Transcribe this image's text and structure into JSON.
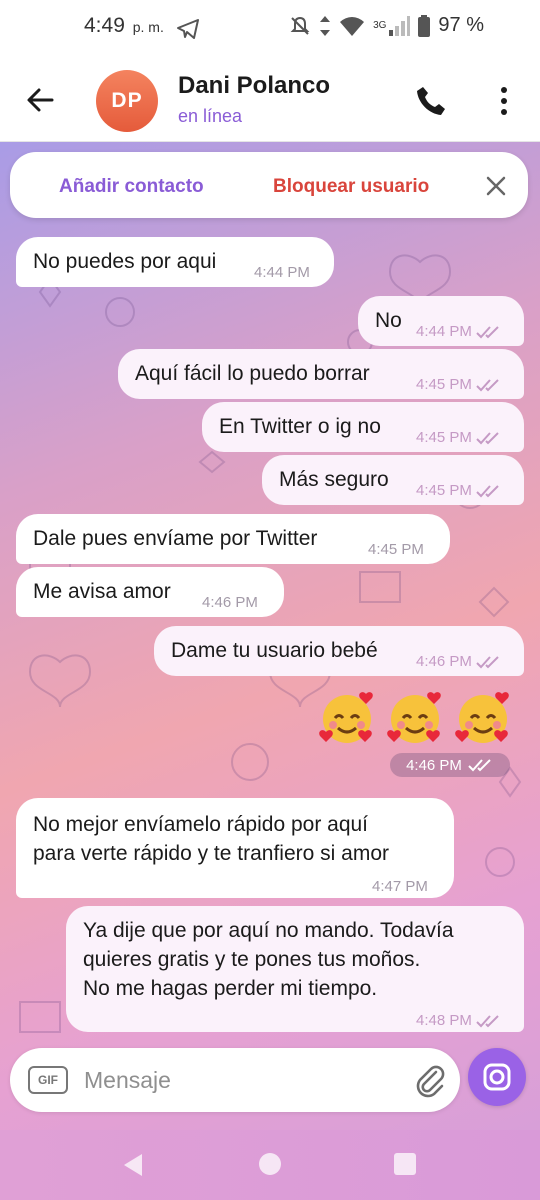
{
  "status_bar": {
    "time": "4:49",
    "time_suffix": "p. m.",
    "network": "3G",
    "battery": "97 %"
  },
  "header": {
    "avatar_initials": "DP",
    "contact_name": "Dani Polanco",
    "contact_status": "en línea",
    "icons": [
      "back-arrow-icon",
      "phone-icon",
      "more-vert-icon"
    ]
  },
  "action_bar": {
    "add_contact": "Añadir contacto",
    "block_user": "Bloquear usuario"
  },
  "messages": [
    {
      "text": "No puedes por aqui",
      "time": "4:44 PM",
      "dir": "in"
    },
    {
      "text": "No",
      "time": "4:44 PM",
      "dir": "out"
    },
    {
      "text": "Aquí fácil lo puedo borrar",
      "time": "4:45 PM",
      "dir": "out"
    },
    {
      "text": "En Twitter o ig no",
      "time": "4:45 PM",
      "dir": "out"
    },
    {
      "text": "Más seguro",
      "time": "4:45 PM",
      "dir": "out"
    },
    {
      "text": "Dale pues envíame por Twitter",
      "time": "4:45 PM",
      "dir": "in"
    },
    {
      "text": "Me avisa amor",
      "time": "4:46 PM",
      "dir": "in"
    },
    {
      "text": "Dame tu usuario bebé",
      "time": "4:46 PM",
      "dir": "out"
    },
    {
      "text": "🥰🥰🥰",
      "time": "4:46 PM",
      "dir": "out"
    },
    {
      "line1": "No mejor envíamelo rápido por aquí",
      "line2": "para verte rápido y te tranfiero si amor",
      "time": "4:47 PM",
      "dir": "in"
    },
    {
      "line1": "Ya dije que por aquí no mando. Todavía",
      "line2": "quieres gratis y te pones tus moños.",
      "line3": "No me hagas perder mi tiempo.",
      "time": "4:48 PM",
      "dir": "out"
    }
  ],
  "composer": {
    "gif_label": "GIF",
    "placeholder": "Mensaje"
  },
  "colors": {
    "accent": "#8a5cd6",
    "block": "#d9453c",
    "avatar": "#ea6a48",
    "camera_button": "#9a62e6"
  }
}
